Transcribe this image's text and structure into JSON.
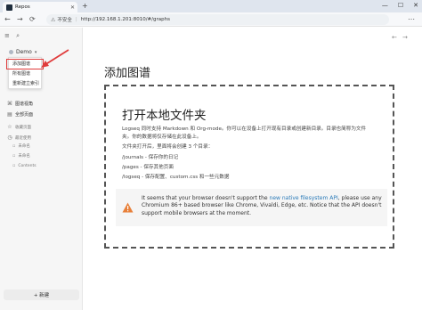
{
  "browser": {
    "tab_title": "Repos",
    "tab_close": "✕",
    "new_tab": "+",
    "window_buttons": [
      "—",
      "☐",
      "✕"
    ],
    "back": "←",
    "forward": "→",
    "reload": "⟳",
    "not_secure": "不安全",
    "url": "http://192.168.1.201:8010/#/graphs",
    "menu": "⋯"
  },
  "sidebar": {
    "graph_name": "Demo",
    "dropdown": [
      "添加图谱",
      "所有图谱",
      "重新建立索引"
    ],
    "items": [
      {
        "icon": "graph-view-icon",
        "label": "图谱视角"
      },
      {
        "icon": "all-pages-icon",
        "label": "全部页面"
      }
    ],
    "favorites_label": "收藏页面",
    "recent_label": "最近使用",
    "recent_items": [
      "未命名",
      "未命名",
      "Contents"
    ],
    "new_page_button": "+ 新建"
  },
  "main": {
    "page_title": "添加图谱",
    "open_folder_title": "打开本地文件夹",
    "desc_line1": "Logseq 同时支持 Markdown 和 Org-mode。你可以在设备上打开现有目录或创建新目录。目录也简称为文件",
    "desc_line2": "夹。你的数据将仅存储在此设备上。",
    "desc_line3": "文件夹打开后，里面将会创建 3 个目录：",
    "dirs": [
      "/journals - 保存你的日记",
      "/pages - 保存其他页面",
      "/logseq - 保存配置、custom.css 和一些元数据"
    ],
    "warning_pre": "It seems that your browser doesn't support the ",
    "warning_link": "new native filesystem API",
    "warning_post": ", please use any Chromium 86+ based browser like Chrome, Vivaldi, Edge, etc. Notice that the API doesn't support mobile browsers at the moment."
  },
  "colors": {
    "accent_red": "#e03b3b",
    "link_blue": "#2a7ab8",
    "warning_orange": "#e8803a"
  }
}
